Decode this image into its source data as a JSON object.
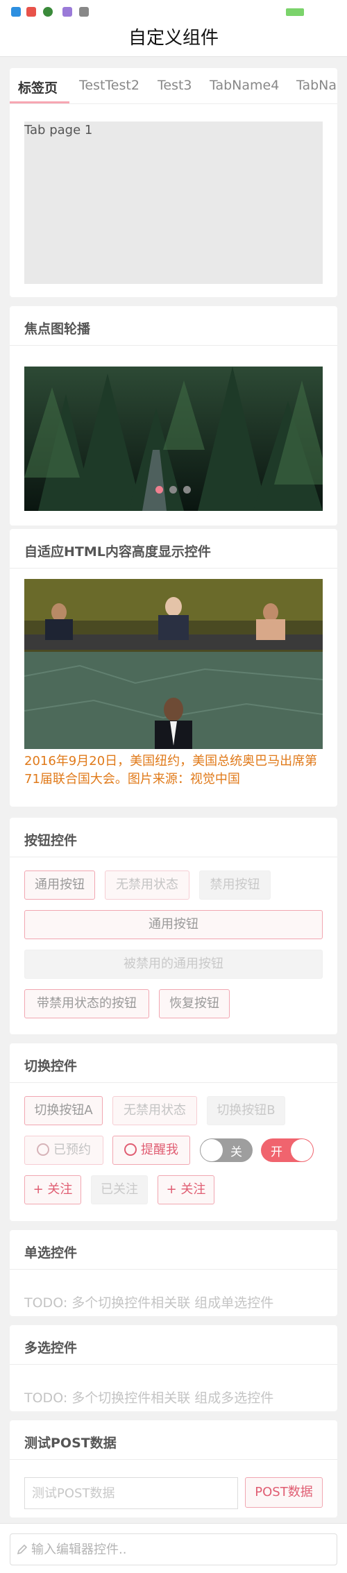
{
  "header": {
    "title": "自定义组件"
  },
  "tabs": {
    "items": [
      "标签页",
      "TestTest2",
      "Test3",
      "TabName4",
      "TabName5"
    ],
    "content": "Tab page 1"
  },
  "carousel": {
    "title": "焦点图轮播",
    "slide_count": 3,
    "active_index": 0
  },
  "html_content": {
    "title": "自适应HTML内容高度显示控件",
    "caption": "2016年9月20日，美国纽约，美国总统奥巴马出席第71届联合国大会。图片来源：视觉中国"
  },
  "buttons": {
    "title": "按钮控件",
    "normal": "通用按钮",
    "no_disabled_state": "无禁用状态",
    "disabled": "禁用按钮",
    "wide_normal": "通用按钮",
    "wide_disabled": "被禁用的通用按钮",
    "with_disabled_state": "带禁用状态的按钮",
    "restore": "恢复按钮"
  },
  "toggles": {
    "title": "切换控件",
    "toggle_a": "切换按钮A",
    "no_disabled_state": "无禁用状态",
    "toggle_b": "切换按钮B",
    "reserved": "已预约",
    "remind_me": "提醒我",
    "switch_off": "关",
    "switch_on": "开",
    "follow": "+ 关注",
    "followed": "已关注",
    "follow2": "+ 关注"
  },
  "radio": {
    "title": "单选控件",
    "todo": "TODO: 多个切换控件相关联 组成单选控件"
  },
  "checkbox": {
    "title": "多选控件",
    "todo": "TODO: 多个切换控件相关联 组成多选控件"
  },
  "post": {
    "title": "测试POST数据",
    "placeholder": "测试POST数据",
    "button": "POST数据"
  },
  "editor": {
    "placeholder": "输入编辑器控件.."
  },
  "colors": {
    "accent": "#f08090",
    "caption": "#e07a1a",
    "switch_off": "#9e9e9e",
    "switch_on": "#f0646e"
  }
}
